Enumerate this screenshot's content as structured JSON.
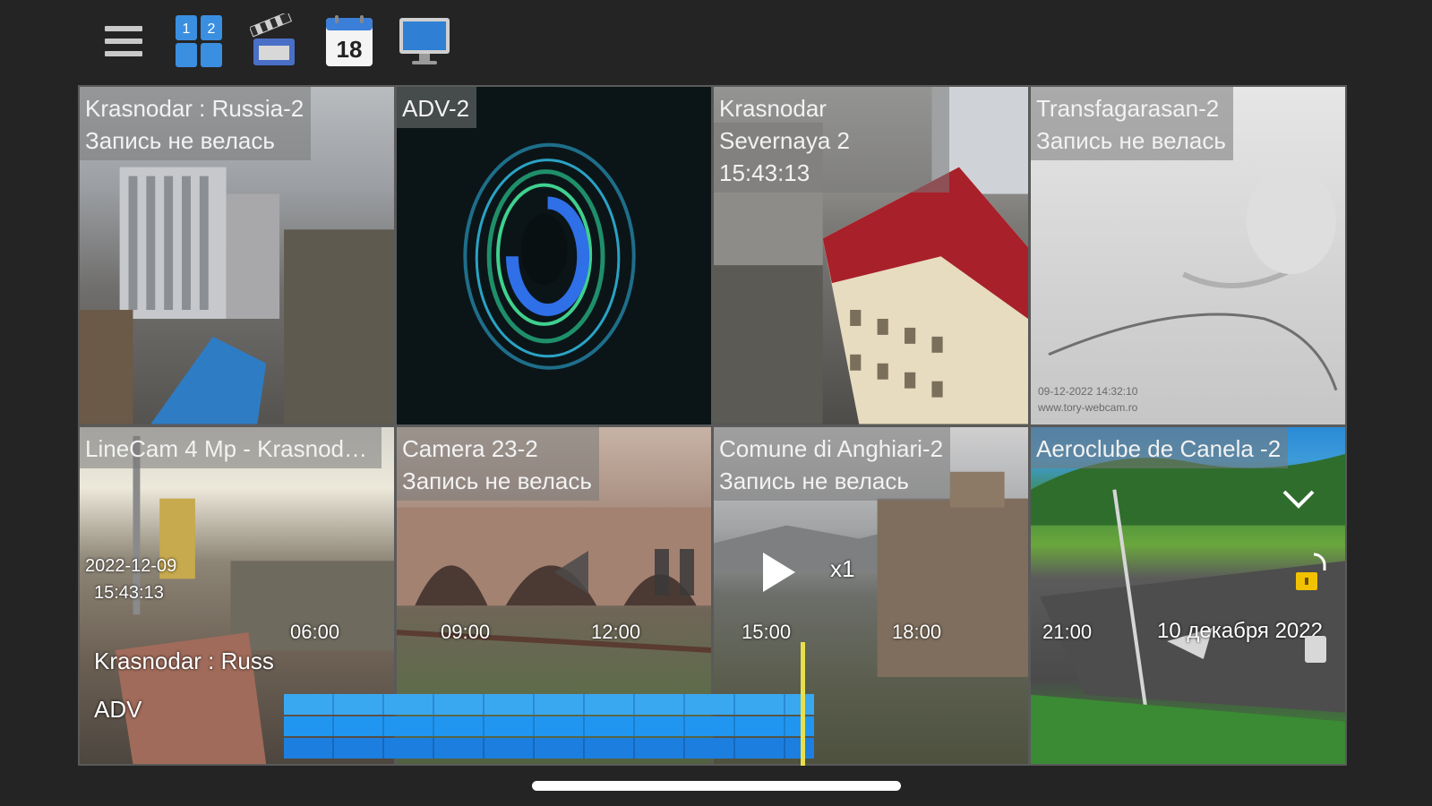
{
  "toolbar": {
    "icons": [
      "menu-icon",
      "grid-layout-icon",
      "clapperboard-icon",
      "calendar-icon",
      "monitor-icon"
    ],
    "calendar_day": "18"
  },
  "tiles": [
    {
      "name": "Krasnodar : Russia-2",
      "status": "Запись не велась",
      "time": ""
    },
    {
      "name": "ADV-2",
      "status": "",
      "time": ""
    },
    {
      "name": "Krasnodar Severnaya 2",
      "status": "",
      "time": "15:43:13"
    },
    {
      "name": "Transfagarasan-2",
      "status": "Запись не велась",
      "time": ""
    },
    {
      "name": "LineCam 4 Mp - Krasnodar...",
      "status": "",
      "time": ""
    },
    {
      "name": "Camera 23-2",
      "status": "Запись не велась",
      "time": ""
    },
    {
      "name": "Comune di Anghiari-2",
      "status": "Запись не велась",
      "time": ""
    },
    {
      "name": "Aeroclube de Canela -2",
      "status": "",
      "time": ""
    }
  ],
  "camera_overlays": {
    "linecam_date": "2022-12-09",
    "linecam_time": "15:43:13",
    "transfagarasan_stamp": "09-12-2022 14:32:10",
    "transfagarasan_site": "www.tory-webcam.ro"
  },
  "playback": {
    "speed": "x1",
    "hours": [
      "06:00",
      "09:00",
      "12:00",
      "15:00",
      "18:00",
      "21:00"
    ],
    "date": "10 декабря 2022",
    "tracks": [
      "Krasnodar : Russ",
      "ADV"
    ],
    "recorded_fraction_end": 0.98
  },
  "colors": {
    "background": "#242424",
    "timeline_bar": "#2196f0",
    "cursor": "#e8e04a",
    "active_border": "#3a8fe0"
  }
}
